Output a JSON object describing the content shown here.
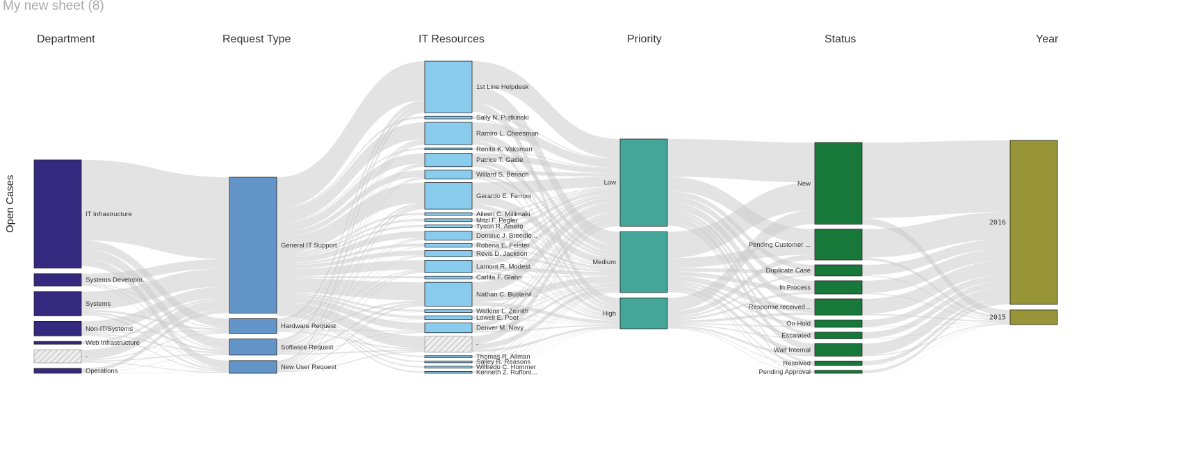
{
  "sheet": {
    "title": "My new sheet (8)"
  },
  "measure_label": "Open Cases",
  "colors": {
    "department": "#35287f",
    "request_type": "#6495c8",
    "it_resources": "#89ccee",
    "priority": "#44a699",
    "status": "#18783a",
    "year": "#979537",
    "link": "#cccccc",
    "null_hatch": "#bbbbbb"
  },
  "columns": [
    {
      "key": "department",
      "header": "Department"
    },
    {
      "key": "request_type",
      "header": "Request Type"
    },
    {
      "key": "it_resources",
      "header": "IT Resources"
    },
    {
      "key": "priority",
      "header": "Priority"
    },
    {
      "key": "status",
      "header": "Status"
    },
    {
      "key": "year",
      "header": "Year"
    }
  ],
  "nodes": {
    "department": [
      {
        "label": "IT Infrastructure",
        "value": 157
      },
      {
        "label": "Systems Developm...",
        "value": 18
      },
      {
        "label": "Systems",
        "value": 35
      },
      {
        "label": "Non-IT/Systems",
        "value": 21
      },
      {
        "label": "Web Infrastructure",
        "value": 4
      },
      {
        "label": "-",
        "value": 19,
        "null": true
      },
      {
        "label": "Operations",
        "value": 7
      }
    ],
    "request_type": [
      {
        "label": "General IT Support",
        "value": 194
      },
      {
        "label": "Hardware Request",
        "value": 21
      },
      {
        "label": "Software Request",
        "value": 23
      },
      {
        "label": "New User Request",
        "value": 18
      }
    ],
    "it_resources": [
      {
        "label": "1st Line Helpdesk",
        "value": 58
      },
      {
        "label": "Sally N. Pujtkinski",
        "value": 3
      },
      {
        "label": "Ramiro L. Cheesman",
        "value": 25
      },
      {
        "label": "Renita K. Vaksman",
        "value": 2
      },
      {
        "label": "Patrice T. Gattie",
        "value": 15
      },
      {
        "label": "Willard S. Benach",
        "value": 10
      },
      {
        "label": "Gerardo E. Ferroni",
        "value": 30
      },
      {
        "label": "Aileen C. Millimaki",
        "value": 3
      },
      {
        "label": "Mitzi F. Pegler",
        "value": 3
      },
      {
        "label": "Tyson R. Amero",
        "value": 3
      },
      {
        "label": "Dominic J. Breedlo...",
        "value": 10
      },
      {
        "label": "Robena E. Feister",
        "value": 4
      },
      {
        "label": "Revis D. Jackson",
        "value": 7
      },
      {
        "label": "Lamont R. Modest",
        "value": 14
      },
      {
        "label": "Carlita F. Glahn",
        "value": 3
      },
      {
        "label": "Nathan C. Bustervi...",
        "value": 27
      },
      {
        "label": "Watkins L. Zeinith",
        "value": 3
      },
      {
        "label": "Lowell E. Poet",
        "value": 4
      },
      {
        "label": "Denver M. Navy",
        "value": 11
      },
      {
        "label": "-",
        "value": 18,
        "null": true
      },
      {
        "label": "Thomas R. Allman",
        "value": 2
      },
      {
        "label": "Salley R. Reasons",
        "value": 2
      },
      {
        "label": "Wilfredo C. Hommer",
        "value": 2
      },
      {
        "label": "Kenneth Z. Ruffont...",
        "value": 2
      }
    ],
    "priority": [
      {
        "label": "Low",
        "value": 125
      },
      {
        "label": "Medium",
        "value": 87
      },
      {
        "label": "High",
        "value": 44
      }
    ],
    "status": [
      {
        "label": "New",
        "value": 111
      },
      {
        "label": "Pending Customer ...",
        "value": 42
      },
      {
        "label": "Duplicate Case",
        "value": 15
      },
      {
        "label": "In Process",
        "value": 18
      },
      {
        "label": "Response received...",
        "value": 22
      },
      {
        "label": "On Hold",
        "value": 10
      },
      {
        "label": "Escalated",
        "value": 9
      },
      {
        "label": "Wait Internal",
        "value": 17
      },
      {
        "label": "Resolved",
        "value": 6
      },
      {
        "label": "Pending Approval",
        "value": 4
      }
    ],
    "year": [
      {
        "label": "2016",
        "value": 235
      },
      {
        "label": "2015",
        "value": 21
      }
    ]
  }
}
